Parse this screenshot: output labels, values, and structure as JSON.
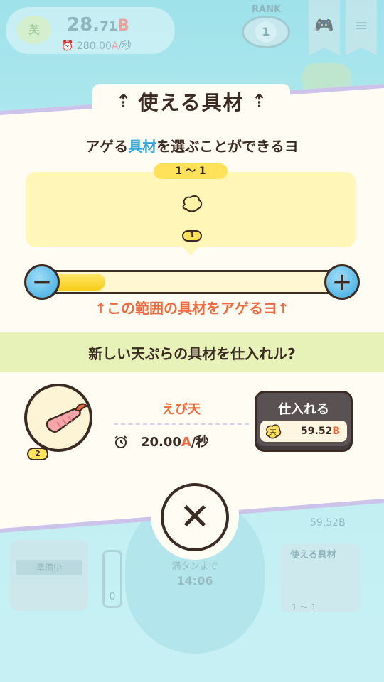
{
  "hud": {
    "coin_glyph": "芙",
    "total_main": "28.",
    "total_decimal": "71",
    "total_unit": "B",
    "rate_value": "280.00",
    "rate_unit": "A",
    "rate_suffix": "/秒",
    "rank_label": "RANK",
    "rank_value": "1",
    "controller_icon": "gamepad-icon",
    "menu_icon": "hamburger-icon"
  },
  "background": {
    "status_label": "準備中",
    "fryer_label": "満タンまで",
    "fryer_time": "14:06",
    "gauge_value": "0",
    "right_price": "59.52B",
    "right_card_title": "使える具材",
    "right_card_range": "1 〜 1"
  },
  "modal": {
    "title": "使える具材",
    "title_arrow": "⇡",
    "subtitle_pre": "アゲる",
    "subtitle_highlight": "具材",
    "subtitle_post": "を選ぶことができるヨ",
    "range_tag": "1 〜 1",
    "ingredient_level": "1",
    "slider_minus": "−",
    "slider_plus": "+",
    "slider_level": 0.2,
    "range_hint": "↑この範囲の具材をアゲるヨ↑",
    "stock_title": "新しい天ぷらの具材を仕入れル?",
    "product": {
      "level": "2",
      "name": "えび天",
      "rate_value": "20.00",
      "rate_unit": "A",
      "rate_suffix": "/秒"
    },
    "buy": {
      "label": "仕入れる",
      "price_value": "59.52",
      "price_unit": "B",
      "coin_glyph": "芙"
    },
    "close_glyph": "✕"
  },
  "colors": {
    "accent_orange": "#ef6a3e",
    "accent_blue": "#36a7d6",
    "yellow": "#ffe25a",
    "dark": "#3b2b22"
  }
}
